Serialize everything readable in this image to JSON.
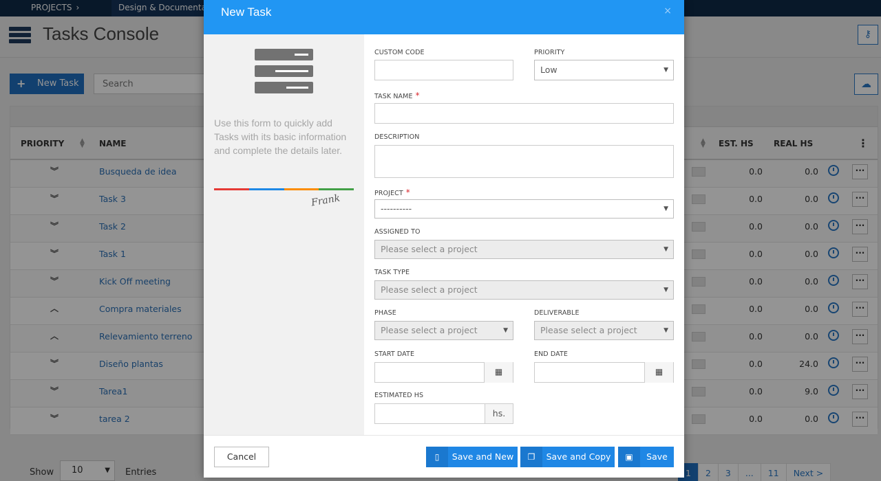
{
  "topnav": {
    "crumb1": "PROJECTS",
    "crumb2": "Design & Documentation"
  },
  "header": {
    "title": "Tasks Console"
  },
  "toolbar": {
    "new_task_label": "New Task",
    "search_placeholder": "Search"
  },
  "table": {
    "headers": {
      "priority": "PRIORITY",
      "name": "NAME",
      "est_hs": "EST. HS",
      "real_hs": "REAL HS"
    },
    "rows": [
      {
        "priority": "low",
        "name": "Busqueda de idea",
        "est": "0.0",
        "real": "0.0"
      },
      {
        "priority": "low",
        "name": "Task 3",
        "est": "0.0",
        "real": "0.0"
      },
      {
        "priority": "low",
        "name": "Task 2",
        "est": "0.0",
        "real": "0.0"
      },
      {
        "priority": "low",
        "name": "Task 1",
        "est": "0.0",
        "real": "0.0"
      },
      {
        "priority": "low",
        "name": "Kick Off meeting",
        "est": "0.0",
        "real": "0.0"
      },
      {
        "priority": "high",
        "name": "Compra materiales",
        "est": "0.0",
        "real": "0.0"
      },
      {
        "priority": "high",
        "name": "Relevamiento terreno",
        "est": "0.0",
        "real": "0.0"
      },
      {
        "priority": "low",
        "name": "Diseño plantas",
        "est": "0.0",
        "real": "24.0"
      },
      {
        "priority": "low",
        "name": "Tarea1",
        "est": "0.0",
        "real": "9.0"
      },
      {
        "priority": "low",
        "name": "tarea 2",
        "est": "0.0",
        "real": "0.0"
      }
    ]
  },
  "footer": {
    "show_label": "Show",
    "page_size": "10",
    "entries_label": "Entries",
    "pages": [
      "1",
      "2",
      "3",
      "...",
      "11",
      "Next >"
    ],
    "active_page": "1"
  },
  "modal": {
    "title": "New Task",
    "close": "×",
    "side_text": "Use this form to quickly add Tasks with its basic information and complete the details later.",
    "signature": "Frank",
    "fields": {
      "custom_code": {
        "label": "CUSTOM CODE",
        "value": ""
      },
      "priority": {
        "label": "PRIORITY",
        "value": "Low"
      },
      "task_name": {
        "label": "TASK NAME",
        "value": ""
      },
      "description": {
        "label": "DESCRIPTION",
        "value": ""
      },
      "project": {
        "label": "PROJECT",
        "value": "----------"
      },
      "assigned_to": {
        "label": "ASSIGNED TO",
        "value": "Please select a project"
      },
      "task_type": {
        "label": "TASK TYPE",
        "value": "Please select a project"
      },
      "phase": {
        "label": "PHASE",
        "value": "Please select a project"
      },
      "deliverable": {
        "label": "DELIVERABLE",
        "value": "Please select a project"
      },
      "start_date": {
        "label": "START DATE",
        "value": ""
      },
      "end_date": {
        "label": "END DATE",
        "value": ""
      },
      "estimated_hs": {
        "label": "ESTIMATED HS",
        "value": "",
        "unit": "hs."
      }
    },
    "buttons": {
      "cancel": "Cancel",
      "save_and_new": "Save and New",
      "save_and_copy": "Save and Copy",
      "save": "Save"
    }
  },
  "colors": {
    "accent": "#2196f3",
    "nav": "#0e2a47",
    "required": "#d9262c",
    "link": "#2a6fb5"
  }
}
